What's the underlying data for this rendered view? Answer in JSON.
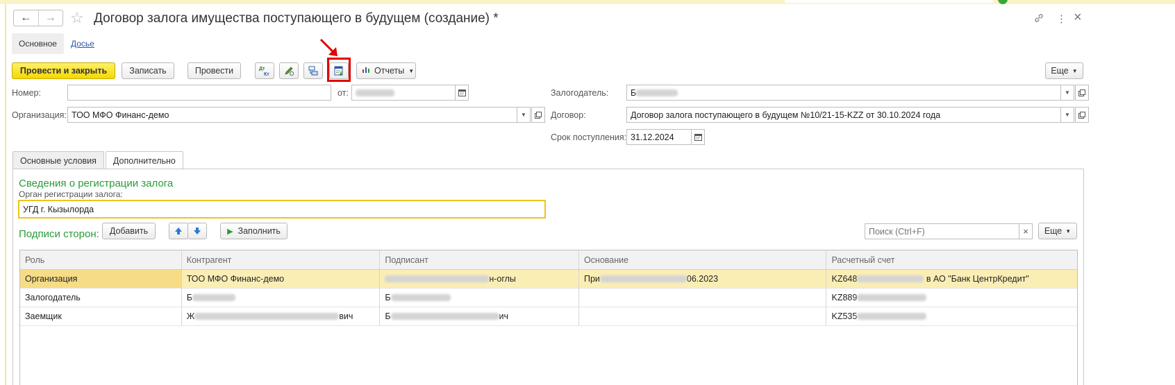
{
  "header": {
    "title": "Договор залога имущества поступающего в будущем (создание) *",
    "back_icon": "arrow-left-icon",
    "forward_icon": "arrow-right-icon",
    "more_glyph": "⋮",
    "close_glyph": "×"
  },
  "nav_tabs": {
    "main": "Основное",
    "dossier": "Досье"
  },
  "toolbar": {
    "post_close": "Провести и закрыть",
    "save": "Записать",
    "post": "Провести",
    "reports": "Отчеты",
    "more": "Еще"
  },
  "form": {
    "number_label": "Номер:",
    "number_value": "",
    "date_label": "от:",
    "org_label": "Организация:",
    "org_value": "ТОО МФО Финанс-демо",
    "pledger_label": "Залогодатель:",
    "pledger_value_prefix": "Б",
    "contract_label": "Договор:",
    "contract_value": "Договор залога поступающего в будущем №10/21-15-KZZ от 30.10.2024 года",
    "term_label": "Срок поступления:",
    "term_value": "31.12.2024"
  },
  "tabs": {
    "basic": "Основные условия",
    "additional": "Дополнительно"
  },
  "registration": {
    "section_title": "Сведения о регистрации залога",
    "organ_label": "Орган регистрации залога:",
    "organ_value": "УГД г. Кызылорда"
  },
  "signatures": {
    "title": "Подписи сторон:",
    "add": "Добавить",
    "fill": "Заполнить",
    "search_placeholder": "Поиск (Ctrl+F)",
    "more": "Еще",
    "columns": [
      "Роль",
      "Контрагент",
      "Подписант",
      "Основание",
      "Расчетный счет"
    ],
    "rows": [
      {
        "role": "Организация",
        "counterparty": "ТОО МФО Финанс-демо",
        "signer_end": "н-оглы",
        "basis_start": "При",
        "basis_end": "06.2023",
        "account_start": "KZ648",
        "account_end": "в АО \"Банк ЦентрКредит\""
      },
      {
        "role": "Залогодатель",
        "counterparty_start": "Б",
        "signer_start": "Б",
        "account_start": "KZ889"
      },
      {
        "role": "Заемщик",
        "counterparty_start": "Ж",
        "counterparty_end": "вич",
        "signer_start": "Б",
        "signer_end": "ич",
        "account_start": "KZ535"
      }
    ]
  }
}
